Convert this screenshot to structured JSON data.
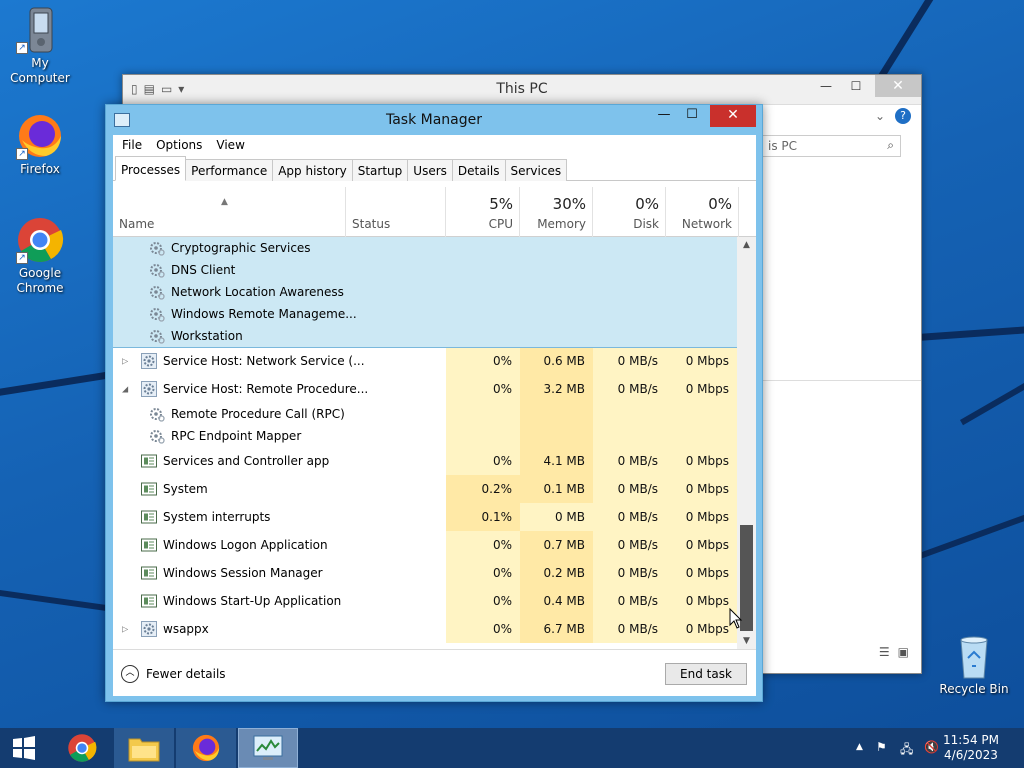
{
  "desktop": {
    "icons": [
      {
        "label": "My Computer",
        "icon": "pda-icon"
      },
      {
        "label": "Firefox",
        "icon": "firefox-icon"
      },
      {
        "label": "Google Chrome",
        "icon": "chrome-icon"
      },
      {
        "label": "Recycle Bin",
        "icon": "recycle-bin-icon"
      }
    ]
  },
  "explorer": {
    "title": "This PC",
    "search_placeholder": "is PC"
  },
  "taskmgr": {
    "title": "Task Manager",
    "menu": [
      "File",
      "Options",
      "View"
    ],
    "tabs": [
      "Processes",
      "Performance",
      "App history",
      "Startup",
      "Users",
      "Details",
      "Services"
    ],
    "active_tab": "Processes",
    "columns": {
      "name": "Name",
      "status": "Status",
      "cpu": {
        "label": "CPU",
        "pct": "5%"
      },
      "memory": {
        "label": "Memory",
        "pct": "30%"
      },
      "disk": {
        "label": "Disk",
        "pct": "0%"
      },
      "network": {
        "label": "Network",
        "pct": "0%"
      }
    },
    "rows": [
      {
        "name": "Cryptographic Services",
        "type": "service",
        "sub": true,
        "selected": true
      },
      {
        "name": "DNS Client",
        "type": "service",
        "sub": true,
        "selected": true
      },
      {
        "name": "Network Location Awareness",
        "type": "service",
        "sub": true,
        "selected": true
      },
      {
        "name": "Windows Remote Manageme...",
        "type": "service",
        "sub": true,
        "selected": true
      },
      {
        "name": "Workstation",
        "type": "service",
        "sub": true,
        "selected": true
      },
      {
        "name": "Service Host: Network Service (...",
        "type": "host",
        "expander": "collapsed",
        "cpu": "0%",
        "mem": "0.6 MB",
        "disk": "0 MB/s",
        "net": "0 Mbps"
      },
      {
        "name": "Service Host: Remote Procedure...",
        "type": "host",
        "expander": "expanded",
        "cpu": "0%",
        "mem": "3.2 MB",
        "disk": "0 MB/s",
        "net": "0 Mbps"
      },
      {
        "name": "Remote Procedure Call (RPC)",
        "type": "service",
        "sub": true
      },
      {
        "name": "RPC Endpoint Mapper",
        "type": "service",
        "sub": true
      },
      {
        "name": "Services and Controller app",
        "type": "app",
        "cpu": "0%",
        "mem": "4.1 MB",
        "disk": "0 MB/s",
        "net": "0 Mbps"
      },
      {
        "name": "System",
        "type": "app",
        "cpu": "0.2%",
        "mem": "0.1 MB",
        "disk": "0 MB/s",
        "net": "0 Mbps"
      },
      {
        "name": "System interrupts",
        "type": "app",
        "cpu": "0.1%",
        "mem": "0 MB",
        "disk": "0 MB/s",
        "net": "0 Mbps"
      },
      {
        "name": "Windows Logon Application",
        "type": "app",
        "cpu": "0%",
        "mem": "0.7 MB",
        "disk": "0 MB/s",
        "net": "0 Mbps"
      },
      {
        "name": "Windows Session Manager",
        "type": "app",
        "cpu": "0%",
        "mem": "0.2 MB",
        "disk": "0 MB/s",
        "net": "0 Mbps"
      },
      {
        "name": "Windows Start-Up Application",
        "type": "app",
        "cpu": "0%",
        "mem": "0.4 MB",
        "disk": "0 MB/s",
        "net": "0 Mbps"
      },
      {
        "name": "wsappx",
        "type": "host",
        "expander": "collapsed",
        "cpu": "0%",
        "mem": "6.7 MB",
        "disk": "0 MB/s",
        "net": "0 Mbps"
      }
    ],
    "fewer_details": "Fewer details",
    "end_task": "End task"
  },
  "taskbar": {
    "items": [
      "start-icon",
      "chrome-icon",
      "file-explorer-icon",
      "firefox-icon",
      "task-manager-icon"
    ],
    "time": "11:54 PM",
    "date": "4/6/2023"
  },
  "colors": {
    "heat_light": "#fff4c4",
    "heat_medium": "#ffe9a6",
    "selection": "#cce8f4",
    "titlebar": "#7ec2ec"
  }
}
